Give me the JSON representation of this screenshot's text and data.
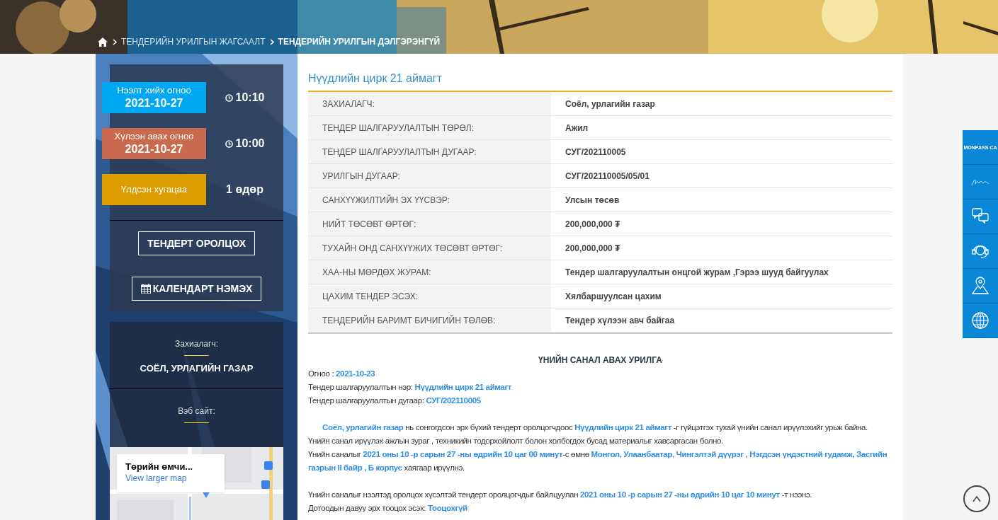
{
  "breadcrumb": [
    {
      "label": "ТЕНДЕРИЙН УРИЛГЫН ЖАГСААЛТ",
      "current": false
    },
    {
      "label": "ТЕНДЕРИЙН УРИЛГЫН ДЭЛГЭРЭНГҮЙ",
      "current": true
    }
  ],
  "deadlines": [
    {
      "kind": "time",
      "label": "Нээлт хийх огноо",
      "date": "2021-10-27",
      "value": "10:10",
      "color": "#00a8f3"
    },
    {
      "kind": "time",
      "label": "Хүлээн авах огноо",
      "date": "2021-10-27",
      "value": "10:00",
      "color": "#c96a4e"
    },
    {
      "kind": "remaining",
      "label": "Үлдсэн хугацаа",
      "value": "1 өдөр",
      "color": "#dc9d00"
    }
  ],
  "actions": [
    {
      "kind": "plain",
      "label": "ТЕНДЕРТ ОРОЛЦОХ"
    },
    {
      "kind": "calendar",
      "label": "КАЛЕНДАРТ НЭМЭХ"
    }
  ],
  "client": {
    "label": "Захиалагч:",
    "value": "СОЁЛ, УРЛАГИЙН ГАЗАР"
  },
  "website": {
    "label": "Вэб сайт:"
  },
  "map": {
    "place": "Төрийн өмчи...",
    "link": "View larger map"
  },
  "title": "Нүүдлийн цирк 21 аймагт",
  "details": [
    {
      "label": "ЗАХИАЛАГЧ:",
      "value": "Соёл, урлагийн газар"
    },
    {
      "label": "ТЕНДЕР ШАЛГАРУУЛАЛТЫН ТӨРӨЛ:",
      "value": "Ажил"
    },
    {
      "label": "ТЕНДЕР ШАЛГАРУУЛАЛТЫН ДУГААР:",
      "value": "СУГ/202110005"
    },
    {
      "label": "УРИЛГЫН ДУГААР:",
      "value": "СУГ/202110005/05/01"
    },
    {
      "label": "САНХҮҮЖИЛТИЙН ЭХ ҮҮСВЭР:",
      "value": "Улсын төсөв"
    },
    {
      "label": "НИЙТ ТӨСӨВТ ӨРТӨГ:",
      "value": "200,000,000 ₮"
    },
    {
      "label": "ТУХАЙН ОНД САНХҮҮЖИХ ТӨСӨВТ ӨРТӨГ:",
      "value": "200,000,000 ₮"
    },
    {
      "label": "ХАА-НЫ МӨРДӨХ ЖУРАМ:",
      "value": "Тендер шалгаруулалтын онцгой журам ,Гэрээ шууд байгуулах"
    },
    {
      "label": "ЦАХИМ ТЕНДЕР ЭСЭХ:",
      "value": "Хялбаршуулсан цахим"
    },
    {
      "label": "ТЕНДЕРИЙН БАРИМТ БИЧИГИЙН ТӨЛӨВ:",
      "value": "Тендер хүлээн авч байгаа"
    }
  ],
  "invitation": {
    "heading": "ҮНИЙН САНАЛ АВАХ УРИЛГА",
    "blocks": [
      {
        "kind": "line",
        "text": "Огноо : **2021-10-23**"
      },
      {
        "kind": "line",
        "text": "Тендер шалгаруулалтын нэр: **Нүүдлийн цирк 21 аймагт**"
      },
      {
        "kind": "line",
        "text": "Тендер шалгаруулалтын дугаар: **СУГ/202110005**"
      },
      {
        "kind": "gap"
      },
      {
        "kind": "indented",
        "text": "**Соёл, урлагийн газар** нь сонгогдсон эрх бүхий тендерт оролцогчдоос **Нүүдлийн цирк 21 аймагт** -г гүйцэтгэх тухай үнийн санал ирүүлэхийг урьж байна."
      },
      {
        "kind": "line",
        "text": "Үнийн санал ирүүлэх ажлын зураг , техникийн тодорхойлолт болон холбогдох бусад материалыг хавсаргасан болно."
      },
      {
        "kind": "line",
        "text": "Үнийн саналыг **2021 оны 10 -р сарын 27 -ны өдрийн 10 цаг 00 минут**-с өмнө **Монгол, Улаанбаатар, Чингэлтэй дүүрэг , Нэгдсэн үндэстний гудамж, Засгийн газрын II байр , Б корпус** хаягаар ирүүлнэ."
      },
      {
        "kind": "gap"
      },
      {
        "kind": "line",
        "text": "Үнийн саналыг нээлтэд оролцох хүсэлтэй тендерт оролцогчдыг байлцуулан **2021 оны 10 -р сарын 27 -ны өдрийн 10 цаг 10 минут** -т нээнэ."
      },
      {
        "kind": "line",
        "text": "Дотоодын давуу эрх тооцох эсэх: **Тооцохгүй**"
      }
    ]
  },
  "side_tools": [
    {
      "kind": "logo",
      "label": "MONPASS CA"
    },
    {
      "kind": "signature"
    },
    {
      "kind": "chat"
    },
    {
      "kind": "support"
    },
    {
      "kind": "location"
    },
    {
      "kind": "globe"
    }
  ]
}
